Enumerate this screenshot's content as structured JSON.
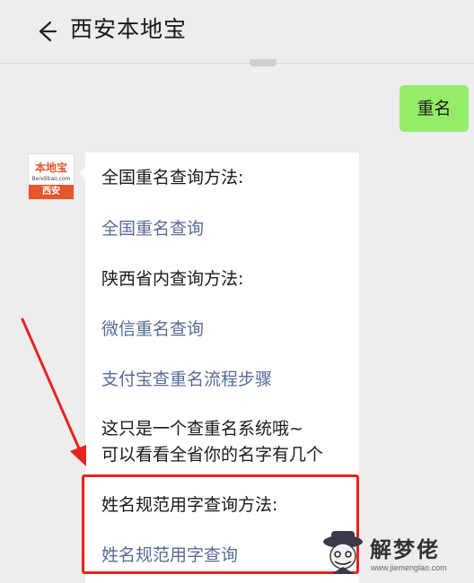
{
  "header": {
    "title": "西安本地宝",
    "back_icon": "back-arrow-icon"
  },
  "chat": {
    "my_message": "重名",
    "bot_avatar": {
      "logo": "本地宝",
      "subtitle": "Bendibao.com",
      "city": "西安"
    },
    "card": {
      "lines": [
        {
          "text": "全国重名查询方法:",
          "style": "heading"
        },
        {
          "text": "全国重名查询",
          "style": "link"
        },
        {
          "text": "陕西省内查询方法:",
          "style": "heading"
        },
        {
          "text": "微信重名查询",
          "style": "link"
        },
        {
          "text": "支付宝查重名流程步骤",
          "style": "link"
        },
        {
          "text": "这只是一个查重名系统哦~",
          "style": "text"
        },
        {
          "text": "可以看看全省你的名字有几个",
          "style": "text"
        },
        {
          "text": "姓名规范用字查询方法:",
          "style": "heading"
        },
        {
          "text": "姓名规范用字查询",
          "style": "link"
        }
      ]
    }
  },
  "annotation": {
    "color": "#e8231f",
    "highlight": "red-box-around-last-section",
    "arrow": "red-arrow-pointing-down"
  },
  "watermark": {
    "text": "解梦佬",
    "url": "www.jiemenglao.com"
  },
  "colors": {
    "background": "#ededed",
    "my_bubble": "#95ec69",
    "link": "#576b95",
    "card": "#ffffff"
  }
}
